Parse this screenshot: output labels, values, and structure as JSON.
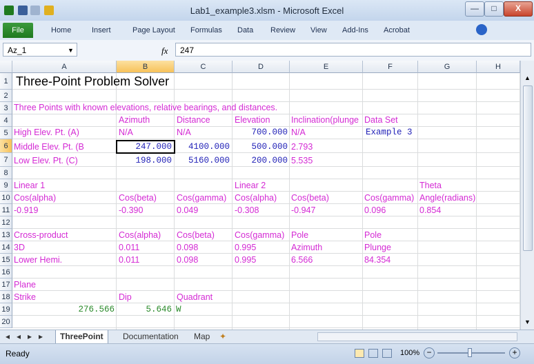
{
  "window": {
    "title": "Lab1_example3.xlsm - Microsoft Excel",
    "buttons": {
      "minimize": "—",
      "maximize": "□",
      "close": "X"
    }
  },
  "ribbon": {
    "tabs": [
      "File",
      "Home",
      "Insert",
      "Page Layout",
      "Formulas",
      "Data",
      "Review",
      "View",
      "Add-Ins",
      "Acrobat"
    ]
  },
  "formula_bar": {
    "name_box": "Az_1",
    "fx": "fx",
    "value": "247"
  },
  "columns": [
    "A",
    "B",
    "C",
    "D",
    "E",
    "F",
    "G",
    "H"
  ],
  "rows": [
    "1",
    "2",
    "3",
    "4",
    "5",
    "6",
    "7",
    "8",
    "9",
    "10",
    "11",
    "12",
    "13",
    "14",
    "15",
    "16",
    "17",
    "18",
    "19",
    "20"
  ],
  "cells": {
    "A1": "Three-Point Problem Solver",
    "A3": "Three Points with known elevations, relative bearings, and distances.",
    "B4": "Azimuth",
    "C4": "Distance",
    "D4": "Elevation",
    "E4": "Inclination(plunge",
    "F4": "Data Set",
    "A5": "High Elev. Pt. (A)",
    "B5": "N/A",
    "C5": "N/A",
    "D5": "700.000",
    "E5": "N/A",
    "F5": "Example 3",
    "A6": "Middle Elev. Pt. (B",
    "B6": "247.000",
    "C6": "4100.000",
    "D6": "500.000",
    "E6": "2.793",
    "A7": "Low Elev. Pt. (C)",
    "B7": "198.000",
    "C7": "5160.000",
    "D7": "200.000",
    "E7": "5.535",
    "A9": "Linear 1",
    "D9": "Linear 2",
    "G9": "Theta",
    "A10": "Cos(alpha)",
    "B10": "Cos(beta)",
    "C10": "Cos(gamma)",
    "D10": "Cos(alpha)",
    "E10": "Cos(beta)",
    "F10": "Cos(gamma)",
    "G10": "Angle(radians)",
    "A11": "-0.919",
    "B11": "-0.390",
    "C11": "0.049",
    "D11": "-0.308",
    "E11": "-0.947",
    "F11": "0.096",
    "G11": "0.854",
    "A13": "Cross-product",
    "B13": "Cos(alpha)",
    "C13": "Cos(beta)",
    "D13": "Cos(gamma)",
    "E13": "Pole",
    "F13": "Pole",
    "A14": "3D",
    "B14": "0.011",
    "C14": "0.098",
    "D14": "0.995",
    "E14": "Azimuth",
    "F14": "Plunge",
    "A15": "Lower Hemi.",
    "B15": "0.011",
    "C15": "0.098",
    "D15": "0.995",
    "E15": "6.566",
    "F15": "84.354",
    "A17": "Plane",
    "A18": "Strike",
    "B18": "Dip",
    "C18": "Quadrant",
    "A19": "276.566",
    "B19": "5.646",
    "C19": "W"
  },
  "sheet_tabs": [
    "ThreePoint",
    "Documentation",
    "Map"
  ],
  "status": {
    "ready": "Ready",
    "zoom": "100%"
  },
  "colors": {
    "magenta": "#d42ad4",
    "blue": "#2323b8",
    "green": "#2a8a2a",
    "active_header": "#f7c25a"
  }
}
